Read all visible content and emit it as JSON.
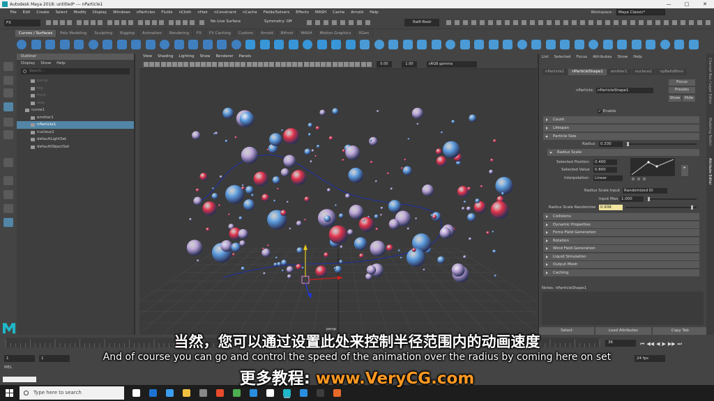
{
  "title_bar": {
    "title": "Autodesk Maya 2018: untitled*  ---  nParticle1"
  },
  "menu": [
    "File",
    "Edit",
    "Create",
    "Select",
    "Modify",
    "Display",
    "Windows",
    "nParticles",
    "Fluids",
    "nCloth",
    "nHair",
    "nConstraint",
    "nCache",
    "Fields/Solvers",
    "Effects",
    "MASH",
    "Cache",
    "Arnold",
    "Help"
  ],
  "workspace": {
    "label": "Workspace :",
    "value": "Maya Classic*"
  },
  "status_line": {
    "mode": "FX",
    "live_surface": "No Live Surface",
    "symmetry": "Symmetry: Off",
    "user": "Ralfi Bedr"
  },
  "shelf_tabs": [
    "Curves / Surfaces",
    "Poly Modeling",
    "Sculpting",
    "Rigging",
    "Animation",
    "Rendering",
    "FX",
    "FX Caching",
    "Custom",
    "Arnold",
    "Bifrost",
    "MASH",
    "Motion Graphics",
    "XGen"
  ],
  "shelf_active": "Curves / Surfaces",
  "outliner": {
    "title": "Outliner",
    "menus": [
      "Display",
      "Show",
      "Help"
    ],
    "search_placeholder": "Search...",
    "items": [
      {
        "label": "persp",
        "state": "dim"
      },
      {
        "label": "top",
        "state": "dim"
      },
      {
        "label": "front",
        "state": "dim"
      },
      {
        "label": "side",
        "state": "dim"
      },
      {
        "label": "curve1",
        "state": "normal"
      },
      {
        "label": "emitter1",
        "state": "normal"
      },
      {
        "label": "nParticle1",
        "state": "selected"
      },
      {
        "label": "nucleus1",
        "state": "normal"
      },
      {
        "label": "defaultLightSet",
        "state": "normal"
      },
      {
        "label": "defaultObjectSet",
        "state": "normal"
      }
    ]
  },
  "viewport": {
    "menus": [
      "View",
      "Shading",
      "Lighting",
      "Show",
      "Renderer",
      "Panels"
    ],
    "field_a": "0.00",
    "field_b": "1.00",
    "color_space": "sRGB gamma",
    "camera_label": "persp"
  },
  "attribute_editor": {
    "menus": [
      "List",
      "Selected",
      "Focus",
      "Attributes",
      "Show",
      "Help"
    ],
    "tabs": [
      "nParticle1",
      "nParticleShape1",
      "emitter1",
      "nucleus1",
      "npBallsBlinn"
    ],
    "active_tab": "nParticleShape1",
    "node_label": "nParticle:",
    "node_value": "nParticleShape1",
    "focus_btn": "Focus",
    "presets_btn": "Presets",
    "show_btn": "Show",
    "hide_btn": "Hide",
    "enable_label": "Enable",
    "sections_top": [
      "Count",
      "Lifespan"
    ],
    "particle_size": "Particle Size",
    "radius_label": "Radius",
    "radius_value": "0.330",
    "radius_scale": "Radius Scale",
    "selected_position_label": "Selected Position",
    "selected_position": "0.400",
    "selected_value_label": "Selected Value",
    "selected_value": "0.800",
    "interpolation_label": "Interpolation",
    "interpolation": "Linear",
    "radius_scale_input_label": "Radius Scale Input",
    "radius_scale_input": "Randomized ID",
    "input_max_label": "Input Max",
    "input_max": "1.000",
    "randomize_label": "Radius Scale Randomize",
    "randomize_value": "0.938",
    "randomize_level": 0.938,
    "sections_bottom": [
      "Collisions",
      "Dynamic Properties",
      "Force Field Generation",
      "Rotation",
      "Wind Field Generation",
      "Liquid Simulation",
      "Output Mesh",
      "Caching"
    ],
    "notes_label": "Notes:  nParticleShape1",
    "bottom_buttons": [
      "Select",
      "Load Attributes",
      "Copy Tab"
    ]
  },
  "side_tabs": [
    "Channel Box / Layer Editor",
    "Modeling Toolkit",
    "Attribute Editor"
  ],
  "time": {
    "range_start": "1",
    "range_inner": "1",
    "current_frame": "36",
    "fps": "24 fps"
  },
  "mel_label": "MEL",
  "taskbar": {
    "search_placeholder": "Type here to search"
  },
  "subtitles": {
    "chinese": "当然，您可以通过设置此处来控制半径范围内的动画速度",
    "english": "And of course you can go and control the speed of the animation over the radius by coming here on set",
    "promo_prefix": "更多教程: ",
    "promo_url": "www.VeryCG.com"
  },
  "colors": {
    "particle_blue": "#5b9bdc",
    "particle_red": "#e0334a",
    "particle_lilac": "#b9a3d6",
    "selection": "#5285a6"
  }
}
